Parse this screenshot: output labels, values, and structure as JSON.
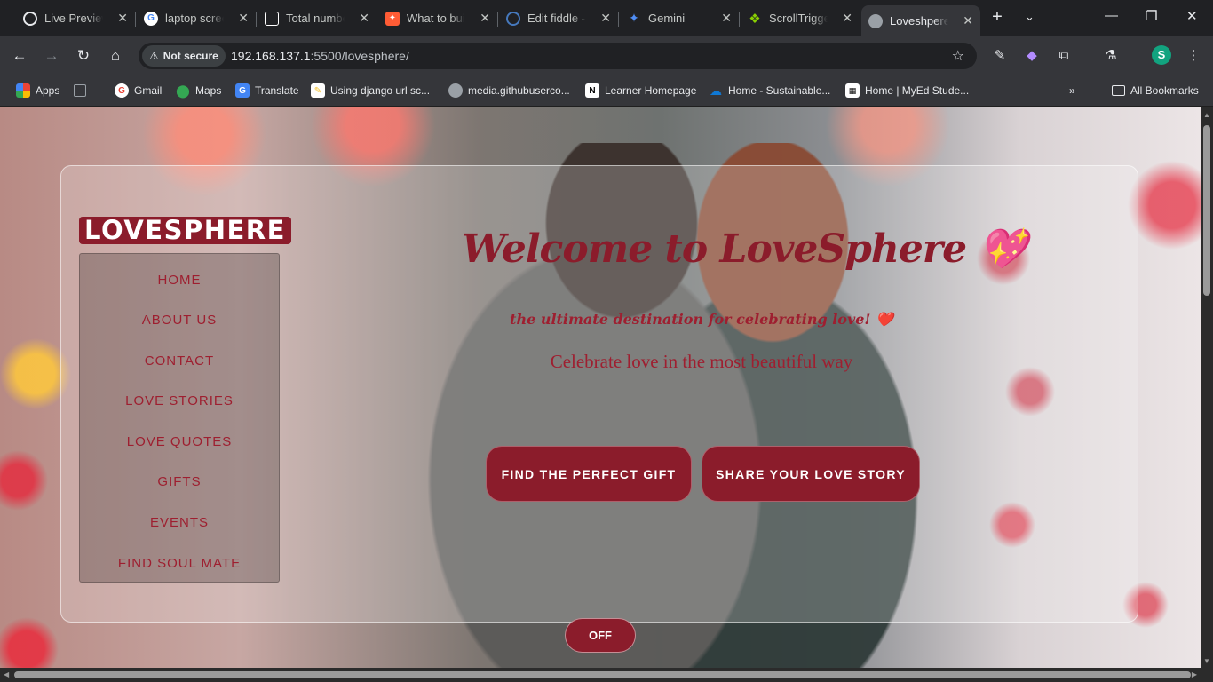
{
  "tabs": [
    {
      "title": "Live Preview",
      "icon": "live-preview-icon",
      "color": "#e8eaed"
    },
    {
      "title": "laptop scree",
      "icon": "google-icon",
      "color": "#4285f4"
    },
    {
      "title": "Total numbe",
      "icon": "codepen-icon",
      "color": "#ffffff"
    },
    {
      "title": "What to buil",
      "icon": "hubspot-icon",
      "color": "#ff5c35"
    },
    {
      "title": "Edit fiddle -",
      "icon": "jsfiddle-icon",
      "color": "#4679bd"
    },
    {
      "title": "Gemini",
      "icon": "gemini-icon",
      "color": "#4f8df5"
    },
    {
      "title": "ScrollTrigge",
      "icon": "gsap-icon",
      "color": "#88ce02"
    },
    {
      "title": "Loveshpere",
      "icon": "globe-icon",
      "color": "#9aa0a6",
      "active": true
    }
  ],
  "toolbar": {
    "not_secure": "Not secure",
    "url_host": "192.168.137.1",
    "url_path": ":5500/lovesphere/",
    "profile_initial": "S"
  },
  "bookmarks": [
    {
      "label": "Apps",
      "icon": "apps-grid-icon",
      "color": "#1a73e8"
    },
    {
      "label": "",
      "icon": "tab-groups-icon",
      "color": "#9aa0a6"
    },
    {
      "label": "Gmail",
      "icon": "google-icon",
      "color": "#ea4335"
    },
    {
      "label": "Maps",
      "icon": "maps-icon",
      "color": "#34a853"
    },
    {
      "label": "Translate",
      "icon": "translate-icon",
      "color": "#4285f4"
    },
    {
      "label": "Using django url sc...",
      "icon": "document-icon",
      "color": "#f6c026"
    },
    {
      "label": "media.githubuserco...",
      "icon": "globe-icon",
      "color": "#9aa0a6"
    },
    {
      "label": "Learner Homepage",
      "icon": "notion-icon",
      "color": "#ffffff"
    },
    {
      "label": "Home - Sustainable...",
      "icon": "onedrive-icon",
      "color": "#0f78d4"
    },
    {
      "label": "Home | MyEd Stude...",
      "icon": "myed-icon",
      "color": "#ffffff"
    },
    {
      "label": "All Bookmarks",
      "icon": "folder-icon",
      "color": "#e8eaed"
    }
  ],
  "site": {
    "logo": "LOVESPHERE",
    "menu": [
      "HOME",
      "ABOUT US",
      "CONTACT",
      "LOVE STORIES",
      "LOVE QUOTES",
      "GIFTS",
      "EVENTS",
      "FIND SOUL MATE"
    ],
    "welcome": "Welcome to LoveSphere",
    "welcome_emoji": "💖",
    "tagline": "the ultimate destination for celebrating love!",
    "tagline_emoji": "❤️",
    "subtitle": "Celebrate love in the most beautiful way",
    "cta_gift": "FIND THE PERFECT GIFT",
    "cta_story": "SHARE YOUR LOVE STORY",
    "toggle_label": "OFF"
  },
  "colors": {
    "brand": "#8b1c2b",
    "menu_text": "#9e1f30"
  }
}
